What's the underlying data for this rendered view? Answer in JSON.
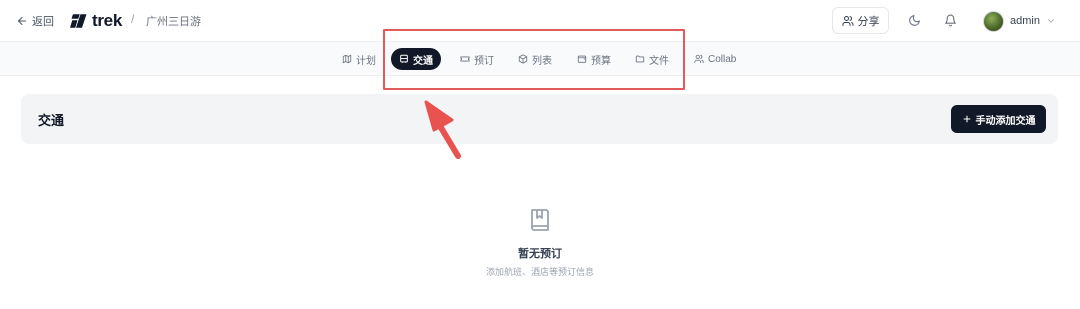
{
  "header": {
    "back_label": "返回",
    "logo_text": "trek",
    "breadcrumb_sep": "/",
    "trip_name": "广州三日游",
    "share_label": "分享",
    "user_name": "admin"
  },
  "tabs": [
    {
      "label": "计划",
      "icon": "map-icon",
      "active": false
    },
    {
      "label": "交通",
      "icon": "ticket-icon",
      "active": true
    },
    {
      "label": "预订",
      "icon": "ticket-icon",
      "active": false
    },
    {
      "label": "列表",
      "icon": "package-icon",
      "active": false
    },
    {
      "label": "预算",
      "icon": "wallet-icon",
      "active": false
    },
    {
      "label": "文件",
      "icon": "folder-icon",
      "active": false
    },
    {
      "label": "Collab",
      "icon": "users-icon",
      "active": false
    }
  ],
  "section": {
    "title": "交通",
    "add_button_label": "手动添加交通"
  },
  "empty_state": {
    "title": "暂无预订",
    "subtitle": "添加航班、酒店等预订信息"
  },
  "colors": {
    "primary": "#111827",
    "highlight": "#e25b5b",
    "section_bg": "#f3f4f6"
  }
}
